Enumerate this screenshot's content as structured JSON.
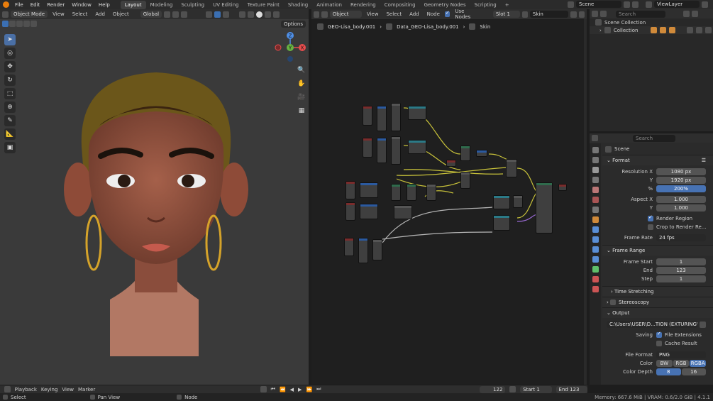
{
  "topbar": {
    "menus": [
      "File",
      "Edit",
      "Render",
      "Window",
      "Help"
    ],
    "workspaces": [
      "Layout",
      "Modeling",
      "Sculpting",
      "UV Editing",
      "Texture Paint",
      "Shading",
      "Animation",
      "Rendering",
      "Compositing",
      "Geometry Nodes",
      "Scripting"
    ],
    "active_workspace": "Layout",
    "add_tab": "+",
    "scene": "Scene",
    "view_layer": "ViewLayer"
  },
  "viewport": {
    "mode": "Object Mode",
    "menus": [
      "View",
      "Select",
      "Add",
      "Object"
    ],
    "transform": "Global",
    "options": "Options",
    "gizmo_x": "X",
    "gizmo_y": "Y",
    "gizmo_z": "Z"
  },
  "node_editor": {
    "type": "Object",
    "menus": [
      "View",
      "Select",
      "Add",
      "Node"
    ],
    "use_nodes": "Use Nodes",
    "slot": "Slot 1",
    "material": "Skin",
    "breadcrumb": [
      "GEO-Lisa_body.001",
      "Data_GEO-Lisa_body.001",
      "Skin"
    ]
  },
  "outliner": {
    "search_placeholder": "Search",
    "scene_collection": "Scene Collection",
    "collection": "Collection"
  },
  "properties": {
    "search_placeholder": "Search",
    "context": "Scene",
    "format_header": "Format",
    "resolution_x_label": "Resolution X",
    "resolution_x": "1080 px",
    "y_label": "Y",
    "resolution_y": "1920 px",
    "percent_label": "%",
    "percent": "200%",
    "aspect_x_label": "Aspect X",
    "aspect_x": "1.000",
    "aspect_y": "1.000",
    "render_region": "Render Region",
    "crop_region": "Crop to Render Re...",
    "frame_rate_label": "Frame Rate",
    "frame_rate": "24 fps",
    "frame_range_header": "Frame Range",
    "frame_start_label": "Frame Start",
    "frame_start": "1",
    "end_label": "End",
    "frame_end": "123",
    "step_label": "Step",
    "frame_step": "1",
    "time_stretching": "Time Stretching",
    "stereoscopy": "Stereoscopy",
    "output_header": "Output",
    "output_path": "C:\\Users\\USER\\D...TION (EXTURING\\",
    "saving_label": "Saving",
    "file_extensions": "File Extensions",
    "cache_result": "Cache Result",
    "file_format_label": "File Format",
    "file_format": "PNG",
    "color_label": "Color",
    "color_options": [
      "BW",
      "RGB",
      "RGBA"
    ],
    "color_active": "RGBA",
    "color_depth_label": "Color Depth",
    "depth_options": [
      "8",
      "16"
    ]
  },
  "timeline": {
    "menus": [
      "Playback",
      "Keying",
      "View",
      "Marker"
    ],
    "current_frame": "122",
    "start_label": "Start",
    "start": "1",
    "end_label": "End",
    "end": "123"
  },
  "status": {
    "select": "Select",
    "pan": "Pan View",
    "node": "Node",
    "stats": "Memory: 667.6 MiB | VRAM: 0.6/2.0 GiB | 4.1.1"
  }
}
